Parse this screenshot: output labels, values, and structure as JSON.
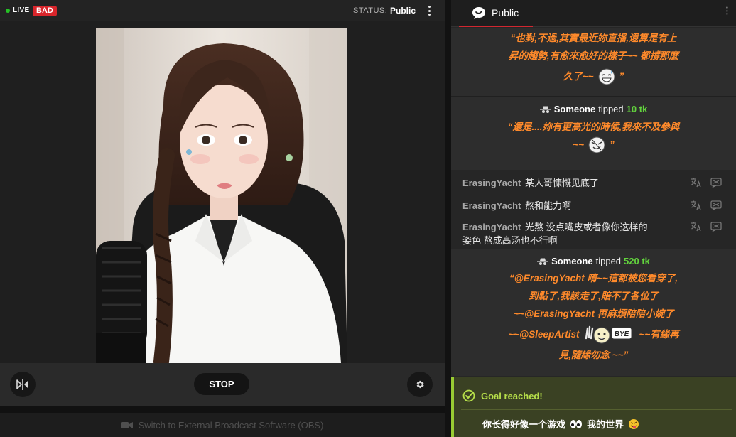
{
  "top_bar": {
    "live_label": "LIVE",
    "quality_badge": "BAD",
    "status_label": "STATUS:",
    "status_value": "Public"
  },
  "controls": {
    "stop_label": "STOP",
    "obs_label": "Switch to External Broadcast Software (OBS)"
  },
  "chat": {
    "tab_label": "Public",
    "tip0": {
      "lines": [
        "“也對,不過,其實最近妳直播,還算是有上",
        "昇的趨勢,有愈來愈好的樣子~~ 都撐那麼"
      ],
      "last_text": "久了~~",
      "quote_end": "”"
    },
    "tip1": {
      "user": "Someone",
      "verb": "tipped",
      "amount": "10 tk",
      "line1": "“還是....妳有更高光的時候,我來不及參與",
      "line2_text": "~~",
      "quote_end": "”"
    },
    "messages": [
      {
        "user": "ErasingYacht",
        "text": "某人哥慷慨见底了"
      },
      {
        "user": "ErasingYacht",
        "text": "熬和能力啊"
      },
      {
        "user": "ErasingYacht",
        "text": "光熬 没点嘴皮或者像你这样的",
        "text2": "姿色 熬成高汤也不行啊"
      }
    ],
    "tip2": {
      "user": "Someone",
      "verb": "tipped",
      "amount": "520 tk",
      "lines": [
        "“@ErasingYacht 唷~~這都被您看穿了,",
        "到點了,我該走了,賠不了各位了",
        "~~@ErasingYacht 再麻煩陪陪小婉了"
      ],
      "line4_a": "~~@SleepArtist",
      "line4_b": "~~有緣再",
      "line5": "見,隨緣勿念 ~~”"
    },
    "goal": {
      "title": "Goal reached!",
      "text_a": "你长得好像一个游戏",
      "text_b": "我的世界"
    }
  },
  "colors": {
    "live": "#25c225",
    "bad": "#d9252b",
    "tip_amount": "#62d33d",
    "tip_message": "#ff8a2b",
    "goal_accent": "#b7e04a",
    "tab_underline": "#d22730"
  }
}
